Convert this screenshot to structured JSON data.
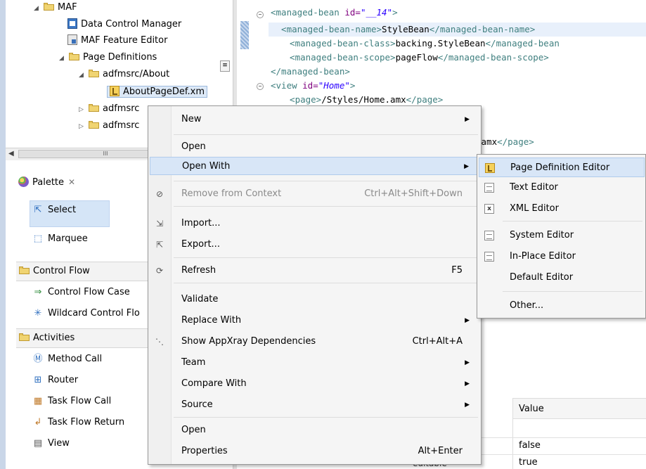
{
  "project_tree": {
    "items": [
      {
        "label": "MAF",
        "kind": "folder",
        "twisty": "expanded"
      },
      {
        "label": "Data Control Manager",
        "kind": "dcm"
      },
      {
        "label": "MAF Feature Editor",
        "kind": "maf"
      },
      {
        "label": "Page Definitions",
        "kind": "folder",
        "twisty": "expanded"
      },
      {
        "label": "adfmsrc/About",
        "kind": "folder",
        "twisty": "expanded"
      },
      {
        "label": "AboutPageDef.xm",
        "kind": "pagedef",
        "selected": true
      },
      {
        "label": "adfmsrc",
        "kind": "folder",
        "twisty": "collapsed"
      },
      {
        "label": "adfmsrc",
        "kind": "folder",
        "twisty": "collapsed"
      }
    ],
    "scroll_thumb": "III"
  },
  "editor": {
    "lines": [
      {
        "parts": [
          {
            "c": "tg",
            "t": "<managed-bean "
          },
          {
            "c": "at",
            "t": "id="
          },
          {
            "c": "av",
            "t": "\"__14\""
          },
          {
            "c": "tg",
            "t": ">"
          }
        ]
      },
      {
        "parts": [
          {
            "c": "tg",
            "t": "  <managed-bean-name>"
          },
          {
            "c": "tx",
            "t": "StyleBean"
          },
          {
            "c": "tg",
            "t": "</managed-bean-name>"
          }
        ]
      },
      {
        "parts": [
          {
            "c": "tg",
            "t": "  <managed-bean-class>"
          },
          {
            "c": "tx",
            "t": "backing.StyleBean"
          },
          {
            "c": "tg",
            "t": "</managed-bean"
          }
        ]
      },
      {
        "parts": [
          {
            "c": "tg",
            "t": "  <managed-bean-scope>"
          },
          {
            "c": "tx",
            "t": "pageFlow"
          },
          {
            "c": "tg",
            "t": "</managed-bean-scope>"
          }
        ]
      },
      {
        "parts": [
          {
            "c": "tg",
            "t": "</managed-bean>"
          }
        ]
      },
      {
        "parts": [
          {
            "c": "tg",
            "t": "<view "
          },
          {
            "c": "at",
            "t": "id="
          },
          {
            "c": "av",
            "t": "\"Home\""
          },
          {
            "c": "tg",
            "t": ">"
          }
        ]
      },
      {
        "parts": [
          {
            "c": "tg",
            "t": "  <page>"
          },
          {
            "c": "tx",
            "t": "/Styles/Home.amx"
          },
          {
            "c": "tg",
            "t": "</page>"
          }
        ]
      },
      {
        "parts": [
          {
            "c": "tx",
            "t": ""
          }
        ]
      },
      {
        "parts": [
          {
            "c": "tx",
            "t": ""
          }
        ]
      },
      {
        "parts": [
          {
            "c": "tx",
            "t": ".amx"
          },
          {
            "c": "tg",
            "t": "</page>"
          }
        ]
      }
    ]
  },
  "palette": {
    "title": "Palette",
    "tools": [
      {
        "label": "Select",
        "icon": "arrow-cursor-icon",
        "glyph": "⇱"
      },
      {
        "label": "Marquee",
        "icon": "marquee-icon",
        "glyph": "⬚"
      }
    ],
    "categories": [
      {
        "label": "Control Flow",
        "items": [
          {
            "label": "Control Flow Case",
            "icon": "arrow-right-icon",
            "glyph": "⇒",
            "color": "#2e8b3a"
          },
          {
            "label": "Wildcard Control Flo",
            "icon": "wildcard-icon",
            "glyph": "✳",
            "color": "#2f6fbf"
          }
        ]
      },
      {
        "label": "Activities",
        "items": [
          {
            "label": "Method Call",
            "icon": "method-call-icon",
            "glyph": "Ⓜ",
            "color": "#2f6fbf"
          },
          {
            "label": "Router",
            "icon": "router-icon",
            "glyph": "⊞",
            "color": "#2f6fbf"
          },
          {
            "label": "Task Flow Call",
            "icon": "task-flow-call-icon",
            "glyph": "▦",
            "color": "#c07a2a"
          },
          {
            "label": "Task Flow Return",
            "icon": "task-flow-return-icon",
            "glyph": "↲",
            "color": "#c07a2a"
          },
          {
            "label": "View",
            "icon": "view-icon",
            "glyph": "▤",
            "color": "#555555"
          }
        ]
      }
    ]
  },
  "properties": {
    "value_header": "Value",
    "values": [
      "false",
      "true"
    ],
    "partial_label": "editable"
  },
  "context_menu": {
    "items": [
      {
        "label": "New",
        "submenu": true
      },
      {
        "sep": true
      },
      {
        "label": "Open"
      },
      {
        "label": "Open With",
        "submenu": true,
        "hover": true
      },
      {
        "sep": true
      },
      {
        "label": "Remove from Context",
        "accel": "Ctrl+Alt+Shift+Down",
        "disabled": true,
        "icon": "remove-context-icon",
        "glyph": "⊘"
      },
      {
        "sep": true
      },
      {
        "label": "Import...",
        "icon": "import-icon",
        "glyph": "⇲"
      },
      {
        "label": "Export...",
        "icon": "export-icon",
        "glyph": "⇱"
      },
      {
        "sep": true
      },
      {
        "label": "Refresh",
        "accel": "F5",
        "icon": "refresh-icon",
        "glyph": "⟳"
      },
      {
        "sep": true
      },
      {
        "label": "Validate"
      },
      {
        "label": "Replace With",
        "submenu": true
      },
      {
        "label": "Show AppXray Dependencies",
        "accel": "Ctrl+Alt+A",
        "icon": "appxray-icon",
        "glyph": "⋱"
      },
      {
        "label": "Team",
        "submenu": true
      },
      {
        "label": "Compare With",
        "submenu": true
      },
      {
        "label": "Source",
        "submenu": true
      },
      {
        "sep": true
      },
      {
        "label": "Open"
      },
      {
        "label": "Properties",
        "accel": "Alt+Enter"
      }
    ]
  },
  "open_with_menu": {
    "items": [
      {
        "label": "Page Definition Editor",
        "icon": "page-definition-icon",
        "hover": true
      },
      {
        "label": "Text Editor",
        "icon": "text-document-icon"
      },
      {
        "label": "XML Editor",
        "icon": "xml-icon"
      },
      {
        "sep": true
      },
      {
        "label": "System Editor",
        "icon": "text-document-icon"
      },
      {
        "label": "In-Place Editor",
        "icon": "text-document-icon"
      },
      {
        "label": "Default Editor",
        "icon": ""
      },
      {
        "sep": true
      },
      {
        "label": "Other...",
        "icon": ""
      }
    ]
  }
}
